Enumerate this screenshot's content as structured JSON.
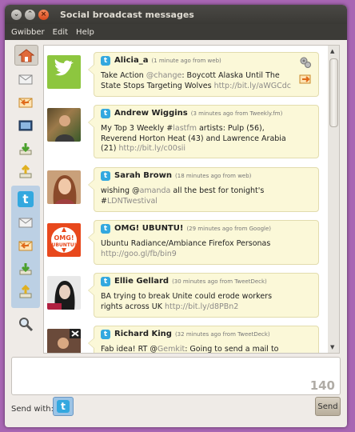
{
  "window": {
    "title": "Social broadcast messages"
  },
  "menu": [
    "Gwibber",
    "Edit",
    "Help"
  ],
  "messages": [
    {
      "name": "Alicia_a",
      "meta": "(1 minute ago from web)",
      "parts": [
        {
          "t": "Take Action "
        },
        {
          "t": "@change",
          "c": "hl"
        },
        {
          "t": ": Boycott Alaska Until The State Stops Targeting Wolves "
        },
        {
          "t": "http://bit.ly/aWGCdc",
          "c": "link"
        }
      ],
      "avatar": "twitter-bird"
    },
    {
      "name": "Andrew Wiggins",
      "meta": "(3 minutes ago from Tweekly.fm)",
      "parts": [
        {
          "t": "My Top 3 Weekly #"
        },
        {
          "t": "lastfm",
          "c": "hl"
        },
        {
          "t": " artists: Pulp (56), Reverend Horton Heat (43) and Lawrence Arabia (21) "
        },
        {
          "t": "http://bit.ly/c00sii",
          "c": "link"
        }
      ],
      "avatar": "photo"
    },
    {
      "name": "Sarah Brown",
      "meta": "(18 minutes ago from web)",
      "parts": [
        {
          "t": "wishing @"
        },
        {
          "t": "amanda",
          "c": "hl"
        },
        {
          "t": " all the best for tonight's #"
        },
        {
          "t": "LDNTwestival",
          "c": "hl"
        }
      ],
      "avatar": "photo"
    },
    {
      "name": "OMG! UBUNTU!",
      "meta": "(29 minutes ago from Google)",
      "parts": [
        {
          "t": "Ubuntu Radiance/Ambiance Firefox Personas "
        },
        {
          "t": "http://goo.gl/fb/bin9",
          "c": "link"
        }
      ],
      "avatar": "omg"
    },
    {
      "name": "Ellie Gellard",
      "meta": "(30 minutes ago from TweetDeck)",
      "parts": [
        {
          "t": "BA trying to break Unite could erode workers rights across UK "
        },
        {
          "t": "http://bit.ly/d8PBn2",
          "c": "link"
        }
      ],
      "avatar": "photo"
    },
    {
      "name": "Richard King",
      "meta": "(32 minutes ago from TweetDeck)",
      "parts": [
        {
          "t": "Fab idea! RT @"
        },
        {
          "t": "Gemkit",
          "c": "hl"
        },
        {
          "t": ": Going to send a mail to local"
        }
      ],
      "avatar": "photo"
    }
  ],
  "omg_logo_text": "OMG! UBUNTU!",
  "compose": {
    "count": "140",
    "send_with_label": "Send with:",
    "send_label": "Send"
  },
  "colors": {
    "accent": "#33a8df",
    "bubble": "#fbf8d8",
    "titlebar": "#3c3b37"
  }
}
